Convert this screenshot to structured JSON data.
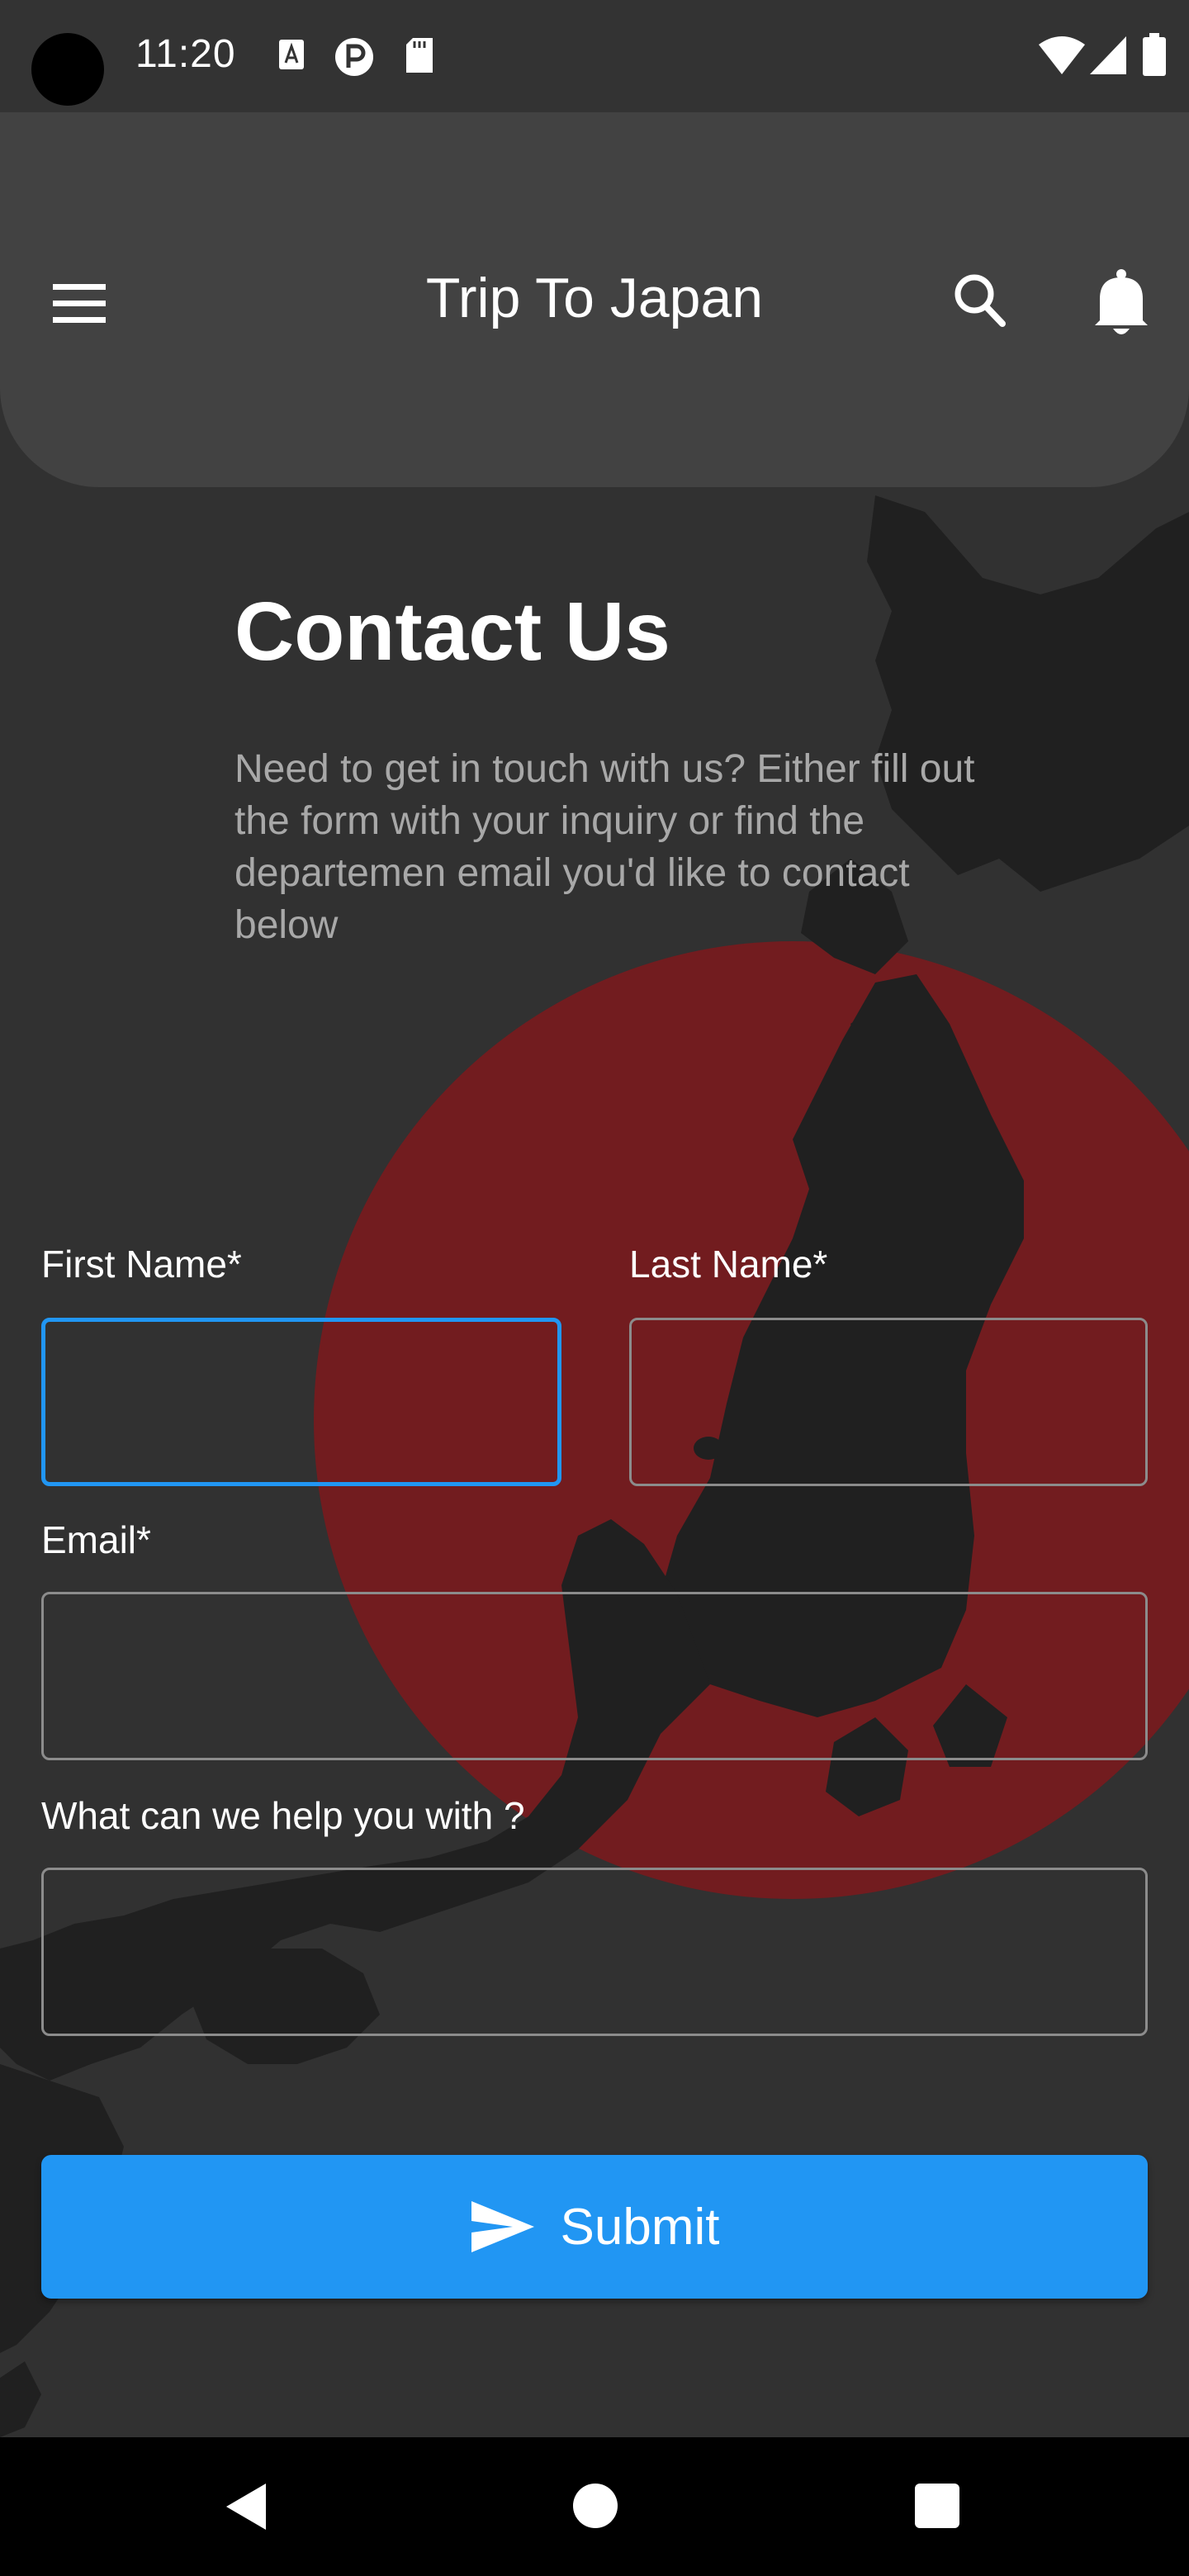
{
  "status_bar": {
    "time": "11:20",
    "icons": [
      "text-a-icon",
      "circle-p-icon",
      "sd-card-icon",
      "wifi-icon",
      "signal-icon",
      "battery-icon"
    ]
  },
  "app_bar": {
    "title": "Trip To Japan",
    "icons": [
      "menu-icon",
      "search-icon",
      "bell-icon"
    ]
  },
  "contact": {
    "title": "Contact Us",
    "description": "Need to get in touch with us? Either fill out the form with your inquiry or find the departemen email you'd like to contact below"
  },
  "form": {
    "first_name_label": "First Name*",
    "last_name_label": "Last Name*",
    "email_label": "Email*",
    "help_label": "What can we help you with ?",
    "first_name_value": "",
    "last_name_value": "",
    "email_value": "",
    "help_value": "",
    "submit_label": "Submit"
  },
  "colors": {
    "background": "#313131",
    "app_bar": "#424242",
    "accent": "#2196f3",
    "sun": "#721c1f",
    "map": "#202020"
  },
  "nav_bar": {
    "icons": [
      "back-icon",
      "home-icon",
      "recents-icon"
    ]
  }
}
